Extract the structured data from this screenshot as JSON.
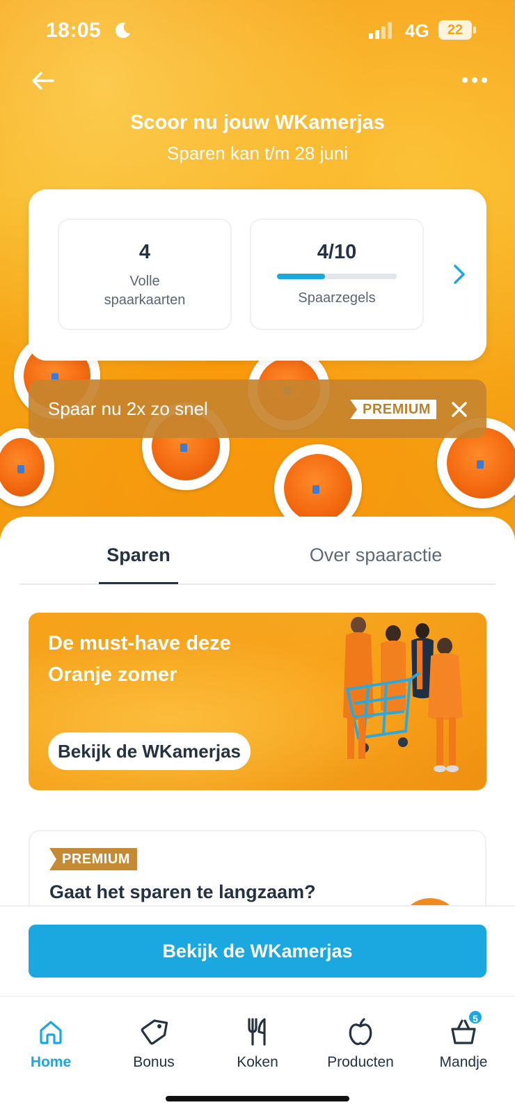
{
  "status_bar": {
    "time": "18:05",
    "network": "4G",
    "battery": "22"
  },
  "header": {
    "title": "Scoor nu jouw WKamerjas",
    "subtitle": "Sparen kan t/m 28 juni"
  },
  "stats": {
    "full_cards_value": "4",
    "full_cards_label": "Volle spaarkaarten",
    "stamps_value": "4/10",
    "stamps_label": "Spaarzegels",
    "stamps_progress": 0.4
  },
  "premium_banner": {
    "text": "Spaar nu 2x zo snel",
    "tag": "PREMIUM"
  },
  "tabs": [
    {
      "label": "Sparen",
      "active": true
    },
    {
      "label": "Over spaaractie",
      "active": false
    }
  ],
  "promo": {
    "title": "De must-have deze Oranje zomer",
    "button_label": "Bekijk de WKamerjas"
  },
  "premium_card": {
    "tag": "PREMIUM",
    "title": "Gaat het sparen te langzaam?"
  },
  "cta": {
    "label": "Bekijk de WKamerjas"
  },
  "nav": [
    {
      "label": "Home",
      "icon": "home-icon",
      "active": true
    },
    {
      "label": "Bonus",
      "icon": "tag-icon",
      "active": false
    },
    {
      "label": "Koken",
      "icon": "cutlery-icon",
      "active": false
    },
    {
      "label": "Producten",
      "icon": "apple-icon",
      "active": false
    },
    {
      "label": "Mandje",
      "icon": "basket-icon",
      "active": false,
      "badge": "5"
    }
  ],
  "colors": {
    "brand_blue": "#1ba8e0",
    "hero_orange": "#f7a21a",
    "premium_gold": "#c58a34",
    "text_dark": "#243241"
  }
}
